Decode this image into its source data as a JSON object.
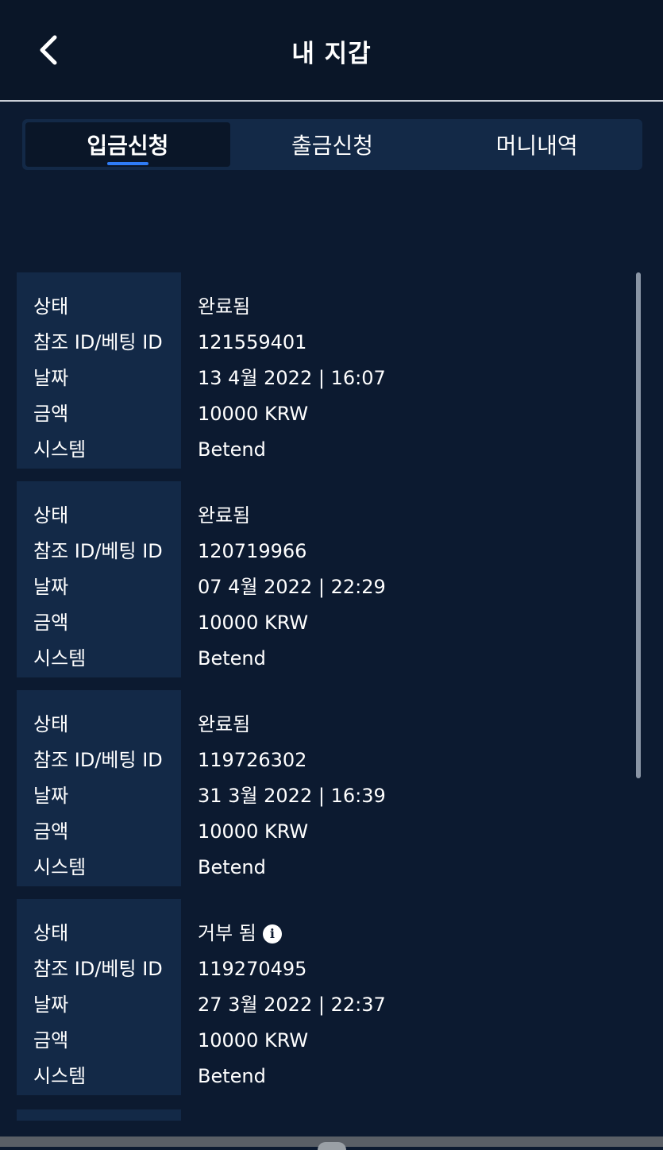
{
  "header": {
    "title": "내 지갑"
  },
  "tabs": [
    {
      "label": "입금신청",
      "active": true
    },
    {
      "label": "출금신청",
      "active": false
    },
    {
      "label": "머니내역",
      "active": false
    }
  ],
  "labels": {
    "status": "상태",
    "ref_id": "참조 ID/베팅 ID",
    "date": "날짜",
    "amount": "금액",
    "system": "시스템"
  },
  "records": [
    {
      "status": "완료됨",
      "ref_id": "121559401",
      "date": "13 4월 2022 | 16:07",
      "amount": "10000 KRW",
      "system": "Betend",
      "info_icon": false
    },
    {
      "status": "완료됨",
      "ref_id": "120719966",
      "date": "07 4월 2022 | 22:29",
      "amount": "10000 KRW",
      "system": "Betend",
      "info_icon": false
    },
    {
      "status": "완료됨",
      "ref_id": "119726302",
      "date": "31 3월 2022 | 16:39",
      "amount": "10000 KRW",
      "system": "Betend",
      "info_icon": false
    },
    {
      "status": "거부 됨",
      "ref_id": "119270495",
      "date": "27 3월 2022 | 22:37",
      "amount": "10000 KRW",
      "system": "Betend",
      "info_icon": true
    }
  ],
  "icons": {
    "back": "chevron-left-icon",
    "info": "info-icon"
  },
  "colors": {
    "background": "#0c1a30",
    "panel": "#132947",
    "accent": "#2f7cf6"
  }
}
